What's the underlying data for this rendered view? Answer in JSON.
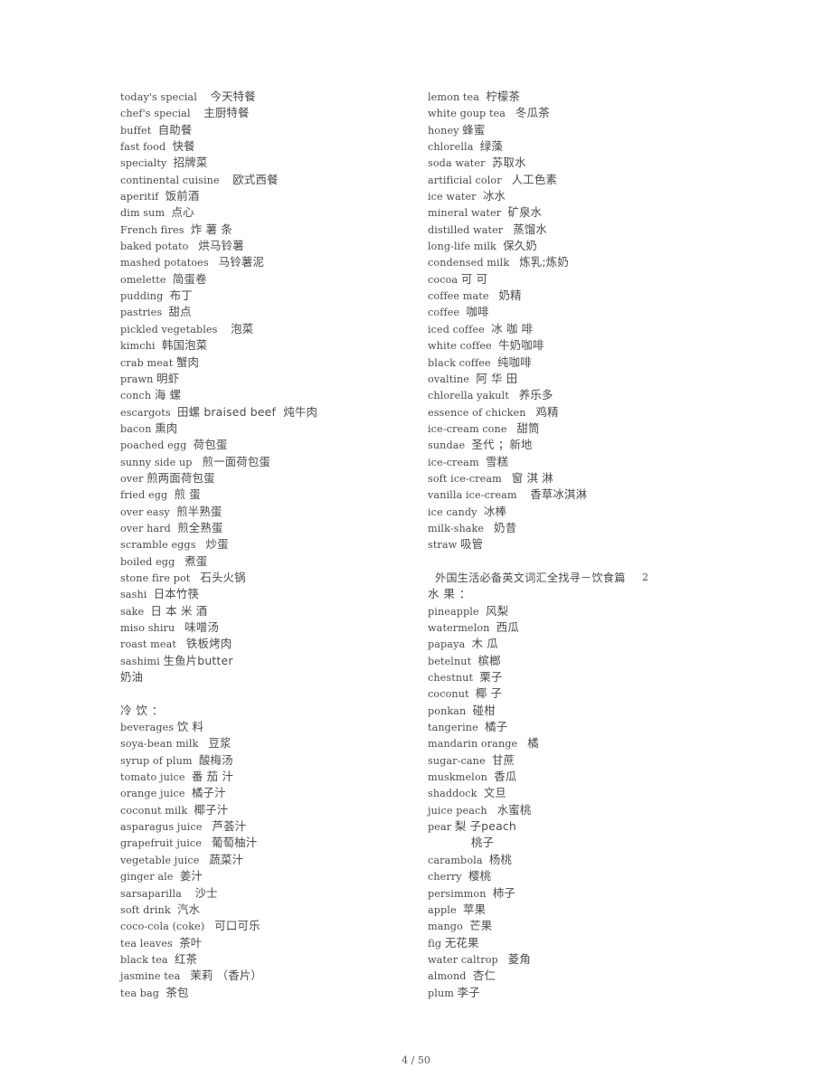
{
  "document": {
    "header_title": "外国生活必备英文词汇全找寻－饮食篇",
    "header_number": "2",
    "footer": "4 / 50"
  },
  "left_column": {
    "entries": [
      {
        "en": "today's special",
        "zh": "今天特餐",
        "gap": "    "
      },
      {
        "en": "chef's special",
        "zh": "主厨特餐",
        "gap": "    "
      },
      {
        "en": "buffet",
        "zh": "自助餐",
        "gap": "  "
      },
      {
        "en": "fast food",
        "zh": "快餐",
        "gap": "  "
      },
      {
        "en": "specialty",
        "zh": "招牌菜",
        "gap": "  "
      },
      {
        "en": "continental cuisine",
        "zh": "欧式西餐",
        "gap": "    "
      },
      {
        "en": "aperitif",
        "zh": "饭前酒",
        "gap": "  "
      },
      {
        "en": "dim sum",
        "zh": "点心",
        "gap": "  "
      },
      {
        "en": "French fires",
        "zh": "炸 薯 条",
        "gap": "  "
      },
      {
        "en": "baked potato",
        "zh": "烘马铃薯",
        "gap": "   "
      },
      {
        "en": "mashed potatoes",
        "zh": "马铃薯泥",
        "gap": "   "
      },
      {
        "en": "omelette",
        "zh": "简蛋卷",
        "gap": "  "
      },
      {
        "en": "pudding",
        "zh": "布丁",
        "gap": "  "
      },
      {
        "en": "pastries",
        "zh": "甜点",
        "gap": "  "
      },
      {
        "en": "pickled vegetables",
        "zh": "泡菜",
        "gap": "    "
      },
      {
        "en": "kimchi",
        "zh": "韩国泡菜",
        "gap": "  "
      },
      {
        "en": "crab meat",
        "zh": "蟹肉",
        "gap": " "
      },
      {
        "en": "prawn",
        "zh": "明虾",
        "gap": " "
      },
      {
        "en": "conch",
        "zh": "海 螺",
        "gap": " "
      },
      {
        "en": "escargots",
        "zh": "田螺 braised beef  炖牛肉",
        "gap": "  "
      },
      {
        "en": "bacon",
        "zh": "熏肉",
        "gap": " "
      },
      {
        "en": "poached egg",
        "zh": "荷包蛋",
        "gap": "  "
      },
      {
        "en": "sunny side up",
        "zh": "煎一面荷包蛋",
        "gap": "   "
      },
      {
        "en": "over",
        "zh": "煎两面荷包蛋",
        "gap": " "
      },
      {
        "en": "fried egg",
        "zh": "煎 蛋",
        "gap": "  "
      },
      {
        "en": "over easy",
        "zh": "煎半熟蛋",
        "gap": "  "
      },
      {
        "en": "over hard",
        "zh": "煎全熟蛋",
        "gap": "  "
      },
      {
        "en": "scramble eggs",
        "zh": "炒蛋",
        "gap": "   "
      },
      {
        "en": "boiled egg",
        "zh": "煮蛋",
        "gap": "   "
      },
      {
        "en": "stone fire pot",
        "zh": "石头火锅",
        "gap": "   "
      },
      {
        "en": "sashi",
        "zh": "日本竹筷",
        "gap": "  "
      },
      {
        "en": "sake",
        "zh": "日 本 米 酒",
        "gap": "  "
      },
      {
        "en": "miso shiru",
        "zh": "味噌汤",
        "gap": "   "
      },
      {
        "en": "roast meat",
        "zh": "铁板烤肉",
        "gap": "   "
      },
      {
        "en": "sashimi",
        "zh": "生鱼片butter",
        "gap": " "
      },
      {
        "en": "",
        "zh": "奶油",
        "gap": ""
      },
      {
        "en": "",
        "zh": "",
        "gap": "",
        "blank": true
      },
      {
        "en": "",
        "zh": "冷 饮 ：",
        "gap": "",
        "heading": true
      },
      {
        "en": "beverages",
        "zh": "饮 料",
        "gap": " "
      },
      {
        "en": "soya-bean milk",
        "zh": "豆浆",
        "gap": "   "
      },
      {
        "en": "syrup of plum",
        "zh": "酸梅汤",
        "gap": "  "
      },
      {
        "en": "tomato juice",
        "zh": "番 茄 汁",
        "gap": "  "
      },
      {
        "en": "orange juice",
        "zh": "橘子汁",
        "gap": "  "
      },
      {
        "en": "coconut milk",
        "zh": "椰子汁",
        "gap": "  "
      },
      {
        "en": "asparagus juice",
        "zh": "芦荟汁",
        "gap": "   "
      },
      {
        "en": "grapefruit juice",
        "zh": "葡萄柚汁",
        "gap": "   "
      },
      {
        "en": "vegetable juice",
        "zh": "蔬菜汁",
        "gap": "   "
      },
      {
        "en": "ginger ale",
        "zh": "姜汁",
        "gap": "  "
      },
      {
        "en": "sarsaparilla",
        "zh": "沙士",
        "gap": "    "
      },
      {
        "en": "soft drink",
        "zh": "汽水",
        "gap": "  "
      },
      {
        "en": "coco-cola (coke)",
        "zh": "可口可乐",
        "gap": "   "
      },
      {
        "en": "tea leaves",
        "zh": "茶叶",
        "gap": "  "
      },
      {
        "en": "black tea",
        "zh": "红茶",
        "gap": "  "
      },
      {
        "en": "jasmine tea",
        "zh": "茉莉 （香片）",
        "gap": "   "
      },
      {
        "en": "tea bag",
        "zh": "茶包",
        "gap": "  "
      }
    ]
  },
  "right_column": {
    "entries_top": [
      {
        "en": "lemon tea",
        "zh": "柠檬茶",
        "gap": "  "
      },
      {
        "en": "white goup tea",
        "zh": "冬瓜茶",
        "gap": "   "
      },
      {
        "en": "honey",
        "zh": "蜂蜜",
        "gap": " "
      },
      {
        "en": "chlorella",
        "zh": "绿藻",
        "gap": "  "
      },
      {
        "en": "soda water",
        "zh": "苏取水",
        "gap": "  "
      },
      {
        "en": "artificial color",
        "zh": "人工色素",
        "gap": "   "
      },
      {
        "en": "ice water",
        "zh": "冰水",
        "gap": "  "
      },
      {
        "en": "mineral water",
        "zh": "矿泉水",
        "gap": "  "
      },
      {
        "en": "distilled water",
        "zh": "蒸馏水",
        "gap": "   "
      },
      {
        "en": "long-life milk",
        "zh": "保久奶",
        "gap": "  "
      },
      {
        "en": "condensed milk",
        "zh": "炼乳;炼奶",
        "gap": "   "
      },
      {
        "en": "cocoa",
        "zh": "可 可",
        "gap": " "
      },
      {
        "en": "coffee mate",
        "zh": "奶精",
        "gap": "   "
      },
      {
        "en": "coffee",
        "zh": "咖啡",
        "gap": "  "
      },
      {
        "en": "iced coffee",
        "zh": "冰 咖 啡",
        "gap": "  "
      },
      {
        "en": "white coffee",
        "zh": "牛奶咖啡",
        "gap": "  "
      },
      {
        "en": "black coffee",
        "zh": "纯咖啡",
        "gap": "  "
      },
      {
        "en": "ovaltine",
        "zh": "阿 华 田",
        "gap": "  "
      },
      {
        "en": "chlorella yakult",
        "zh": "养乐多",
        "gap": "   "
      },
      {
        "en": "essence of chicken",
        "zh": "鸡精",
        "gap": "   "
      },
      {
        "en": "ice-cream cone",
        "zh": "甜筒",
        "gap": "   "
      },
      {
        "en": "sundae",
        "zh": "圣代 ；新地",
        "gap": "  "
      },
      {
        "en": "ice-cream",
        "zh": "雪糕",
        "gap": "  "
      },
      {
        "en": "soft ice-cream",
        "zh": "窗 淇 淋",
        "gap": "   "
      },
      {
        "en": "vanilla ice-cream",
        "zh": "香草冰淇淋",
        "gap": "    "
      },
      {
        "en": "ice candy",
        "zh": "冰棒",
        "gap": "  "
      },
      {
        "en": "milk-shake",
        "zh": "奶昔",
        "gap": "   "
      },
      {
        "en": "straw",
        "zh": "吸管",
        "gap": " "
      }
    ],
    "fruit_heading": "水 果 ：",
    "entries_bottom": [
      {
        "en": "pineapple",
        "zh": "风梨",
        "gap": "  "
      },
      {
        "en": "watermelon",
        "zh": "西瓜",
        "gap": "  "
      },
      {
        "en": "papaya",
        "zh": "木 瓜",
        "gap": "  "
      },
      {
        "en": "betelnut",
        "zh": "槟榔",
        "gap": "  "
      },
      {
        "en": "chestnut",
        "zh": "栗子",
        "gap": "  "
      },
      {
        "en": "coconut",
        "zh": "椰 子",
        "gap": "  "
      },
      {
        "en": "ponkan",
        "zh": "碰柑",
        "gap": "  "
      },
      {
        "en": "tangerine",
        "zh": "橘子",
        "gap": "  "
      },
      {
        "en": "mandarin orange",
        "zh": "橘",
        "gap": "   "
      },
      {
        "en": "sugar-cane",
        "zh": "甘蔗",
        "gap": "  "
      },
      {
        "en": "muskmelon",
        "zh": "香瓜",
        "gap": "  "
      },
      {
        "en": "shaddock",
        "zh": "文旦",
        "gap": "  "
      },
      {
        "en": "juice peach",
        "zh": "水蜜桃",
        "gap": "   "
      },
      {
        "en": "pear",
        "zh": "梨 子peach",
        "gap": " "
      },
      {
        "en": "",
        "zh": "桃子",
        "gap": "",
        "indent": true
      },
      {
        "en": "carambola",
        "zh": "杨桃",
        "gap": "  "
      },
      {
        "en": "cherry",
        "zh": "樱桃",
        "gap": "  "
      },
      {
        "en": "persimmon",
        "zh": "柿子",
        "gap": "  "
      },
      {
        "en": "apple",
        "zh": "苹果",
        "gap": "  "
      },
      {
        "en": "mango",
        "zh": "芒果",
        "gap": "  "
      },
      {
        "en": "fig",
        "zh": "无花果",
        "gap": " "
      },
      {
        "en": "water caltrop",
        "zh": "菱角",
        "gap": "   "
      },
      {
        "en": "almond",
        "zh": "杏仁",
        "gap": "  "
      },
      {
        "en": "plum",
        "zh": "李子",
        "gap": " "
      }
    ]
  }
}
